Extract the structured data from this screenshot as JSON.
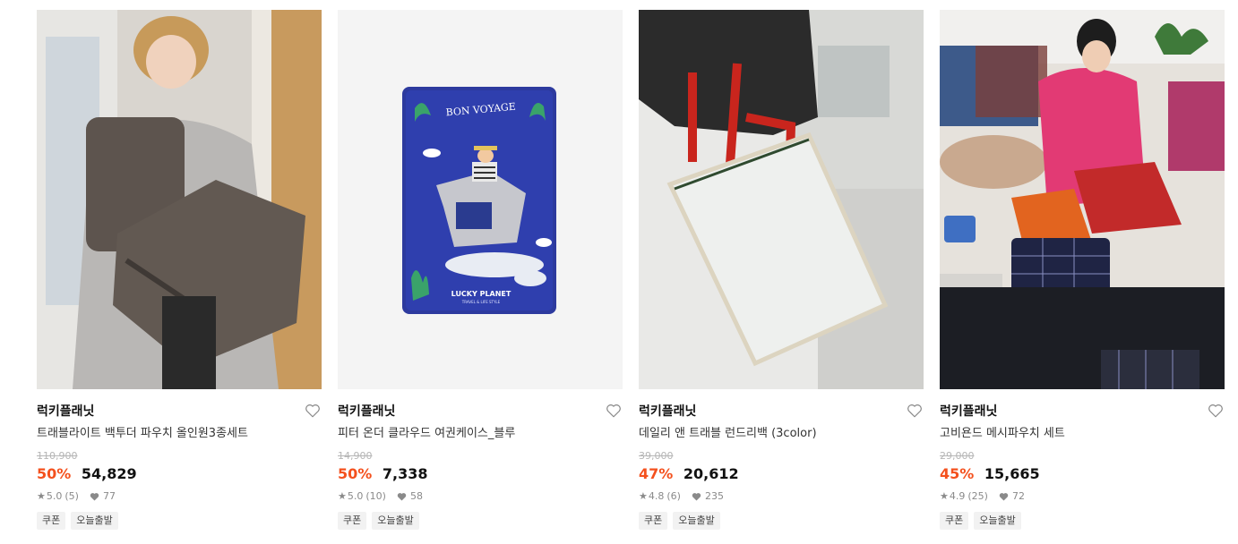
{
  "products": [
    {
      "brand": "럭키플래닛",
      "title": "트래블라이트 백투더 파우치 올인원3종세트",
      "original_price": "110,900",
      "discount": "50%",
      "price": "54,829",
      "rating": "5.0",
      "reviews": "(5)",
      "likes": "77",
      "tags": [
        "쿠폰",
        "오늘출발"
      ]
    },
    {
      "brand": "럭키플래닛",
      "title": "피터 온더 클라우드 여권케이스_블루",
      "original_price": "14,900",
      "discount": "50%",
      "price": "7,338",
      "rating": "5.0",
      "reviews": "(10)",
      "likes": "58",
      "tags": [
        "쿠폰",
        "오늘출발"
      ],
      "case_text": {
        "top": "BON VOYAGE",
        "brand": "LUCKY PLANET",
        "sub": "TRAVEL & LIFE STYLE"
      }
    },
    {
      "brand": "럭키플래닛",
      "title": "데일리 앤 트래블 런드리백 (3color)",
      "original_price": "39,000",
      "discount": "47%",
      "price": "20,612",
      "rating": "4.8",
      "reviews": "(6)",
      "likes": "235",
      "tags": [
        "쿠폰",
        "오늘출발"
      ]
    },
    {
      "brand": "럭키플래닛",
      "title": "고비욘드 메시파우치 세트",
      "original_price": "29,000",
      "discount": "45%",
      "price": "15,665",
      "rating": "4.9",
      "reviews": "(25)",
      "likes": "72",
      "tags": [
        "쿠폰",
        "오늘출발"
      ]
    }
  ],
  "colors": {
    "discount": "#f4511e",
    "tag_bg": "#f2f2f2"
  },
  "icons": {
    "wishlist": "heart-outline-icon",
    "rating": "star-icon",
    "likes": "heart-filled-icon"
  }
}
